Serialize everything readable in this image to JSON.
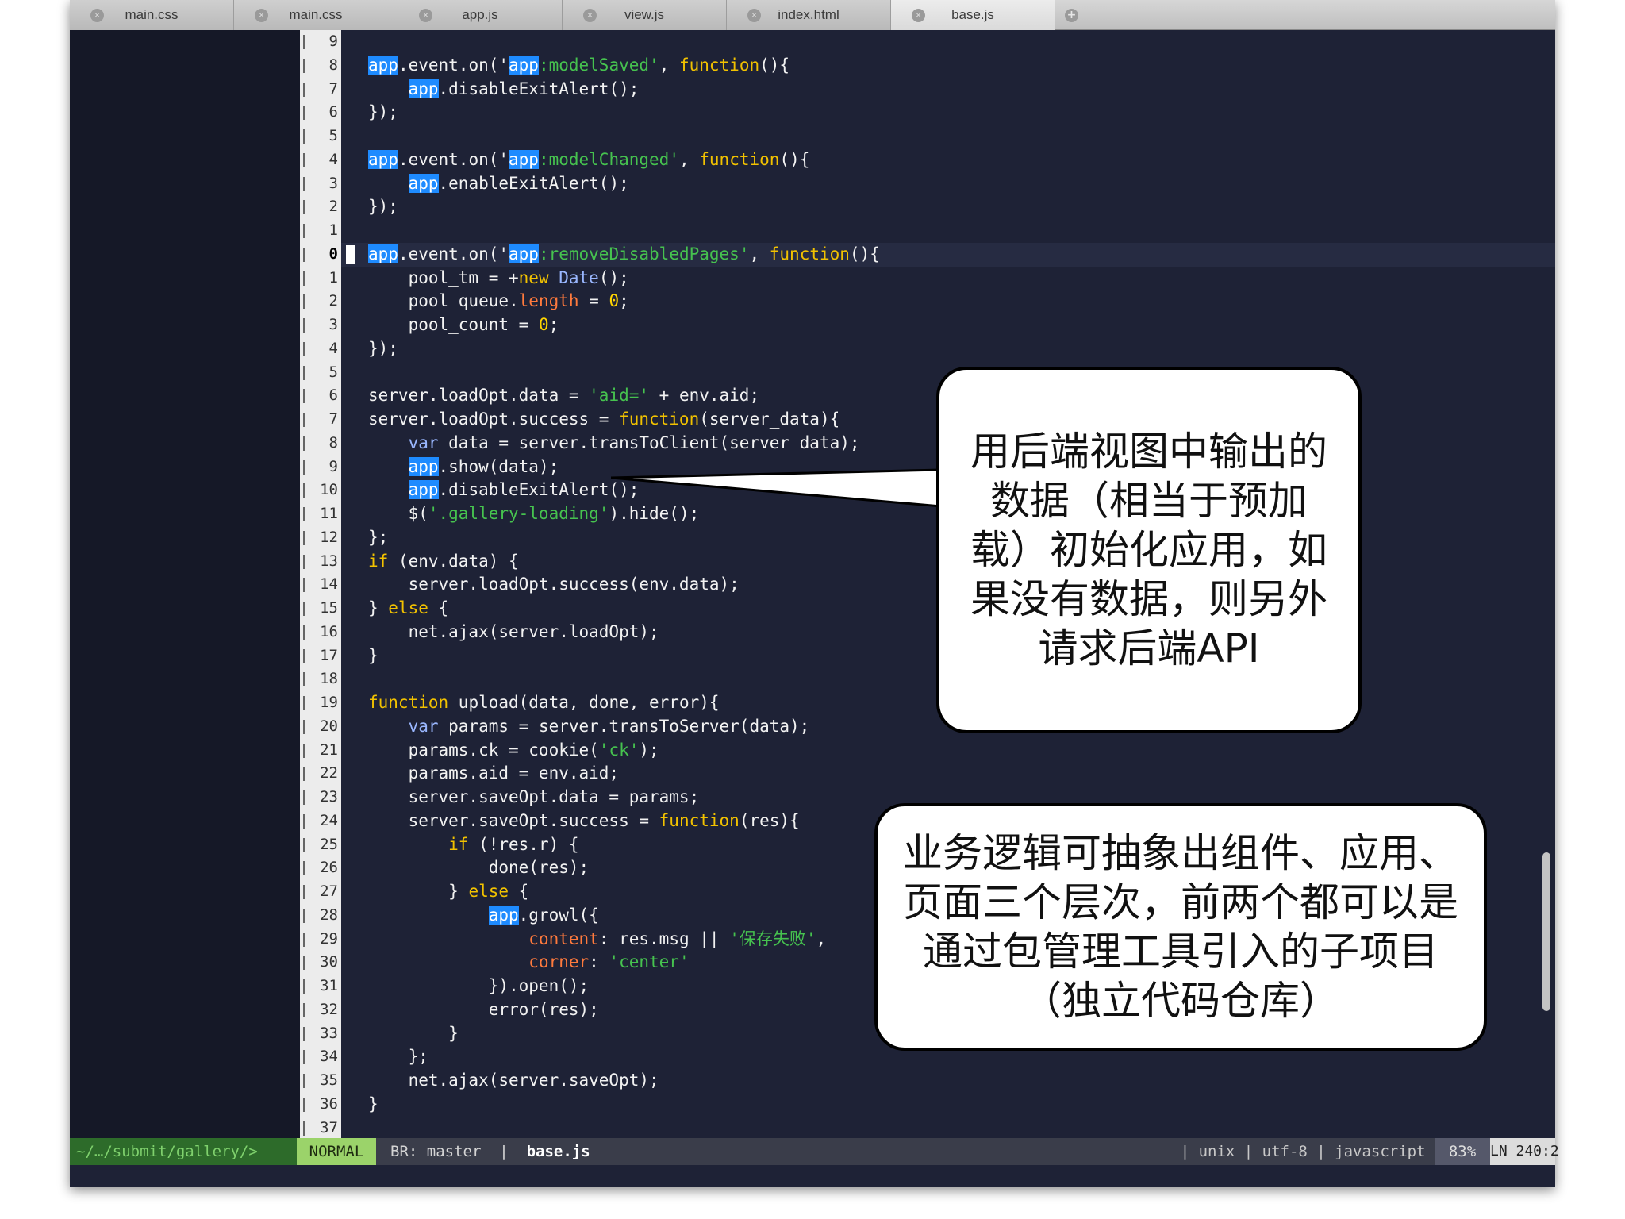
{
  "tabs": [
    "main.css",
    "main.css",
    "app.js",
    "view.js",
    "index.html",
    "base.js"
  ],
  "active_tab_index": 5,
  "code_lines": [
    {
      "num": "9",
      "html": ""
    },
    {
      "num": "8",
      "html": "<span class=\"hl\">app</span>.event.on('<span class=\"hl\">app</span><span class=\"str\">:modelSaved'</span>, <span class=\"kw\">function</span>(){"
    },
    {
      "num": "7",
      "html": "    <span class=\"hl\">app</span>.disableExitAlert();"
    },
    {
      "num": "6",
      "html": "});"
    },
    {
      "num": "5",
      "html": ""
    },
    {
      "num": "4",
      "html": "<span class=\"hl\">app</span>.event.on('<span class=\"hl\">app</span><span class=\"str\">:modelChanged'</span>, <span class=\"kw\">function</span>(){"
    },
    {
      "num": "3",
      "html": "    <span class=\"hl\">app</span>.enableExitAlert();"
    },
    {
      "num": "2",
      "html": "});"
    },
    {
      "num": "1",
      "html": ""
    },
    {
      "num": "0",
      "html": "<span class=\"hl\">app</span>.event.on('<span class=\"hl\">app</span><span class=\"str\">:removeDisabledPages'</span>, <span class=\"kw\">function</span>(){",
      "current": true
    },
    {
      "num": "1",
      "html": "    pool_tm = +<span class=\"kw\">new</span> <span class=\"blue\">Date</span>();"
    },
    {
      "num": "2",
      "html": "    pool_queue.<span class=\"prop\">length</span> = <span class=\"num0\">0</span>;"
    },
    {
      "num": "3",
      "html": "    pool_count = <span class=\"num0\">0</span>;"
    },
    {
      "num": "4",
      "html": "});"
    },
    {
      "num": "5",
      "html": ""
    },
    {
      "num": "6",
      "html": "server.loadOpt.data = <span class=\"str\">'aid='</span> + env.aid;"
    },
    {
      "num": "7",
      "html": "server.loadOpt.success = <span class=\"kw\">function</span>(server_data){"
    },
    {
      "num": "8",
      "html": "    <span class=\"blue\">var</span> data = server.transToClient(server_data);"
    },
    {
      "num": "9",
      "html": "    <span class=\"hl\">app</span>.show(data);"
    },
    {
      "num": "10",
      "html": "    <span class=\"hl\">app</span>.disableExitAlert();"
    },
    {
      "num": "11",
      "html": "    $(<span class=\"str\">'.gallery-loading'</span>).hide();"
    },
    {
      "num": "12",
      "html": "};"
    },
    {
      "num": "13",
      "html": "<span class=\"kw\">if</span> (env.data) {"
    },
    {
      "num": "14",
      "html": "    server.loadOpt.success(env.data);"
    },
    {
      "num": "15",
      "html": "} <span class=\"kw\">else</span> {"
    },
    {
      "num": "16",
      "html": "    net.ajax(server.loadOpt);"
    },
    {
      "num": "17",
      "html": "}"
    },
    {
      "num": "18",
      "html": ""
    },
    {
      "num": "19",
      "html": "<span class=\"kw\">function</span> upload(data, done, error){"
    },
    {
      "num": "20",
      "html": "    <span class=\"blue\">var</span> params = server.transToServer(data);"
    },
    {
      "num": "21",
      "html": "    params.ck = cookie(<span class=\"str\">'ck'</span>);"
    },
    {
      "num": "22",
      "html": "    params.aid = env.aid;"
    },
    {
      "num": "23",
      "html": "    server.saveOpt.data = params;"
    },
    {
      "num": "24",
      "html": "    server.saveOpt.success = <span class=\"kw\">function</span>(res){"
    },
    {
      "num": "25",
      "html": "        <span class=\"kw\">if</span> (!res.r) {"
    },
    {
      "num": "26",
      "html": "            done(res);"
    },
    {
      "num": "27",
      "html": "        } <span class=\"kw\">else</span> {"
    },
    {
      "num": "28",
      "html": "            <span class=\"hl\">app</span>.growl({"
    },
    {
      "num": "29",
      "html": "                <span class=\"prop\">content</span>: res.msg || <span class=\"str\">'保存失败'</span>,"
    },
    {
      "num": "30",
      "html": "                <span class=\"prop\">corner</span>: <span class=\"str\">'center'</span>"
    },
    {
      "num": "31",
      "html": "            }).open();"
    },
    {
      "num": "32",
      "html": "            error(res);"
    },
    {
      "num": "33",
      "html": "        }"
    },
    {
      "num": "34",
      "html": "    };"
    },
    {
      "num": "35",
      "html": "    net.ajax(server.saveOpt);"
    },
    {
      "num": "36",
      "html": "}"
    },
    {
      "num": "37",
      "html": ""
    }
  ],
  "status": {
    "path": "~/…/submit/gallery/>",
    "mode": "NORMAL",
    "branch": "BR: master  |  ",
    "file": "base.js",
    "right": "| unix | utf-8 | javascript ",
    "percent": "83%",
    "position": "LN 240:2"
  },
  "callouts": {
    "first": "用后端视图中输出的数据（相当于预加载）初始化应用，如果没有数据，则另外请求后端API",
    "second": "业务逻辑可抽象出组件、应用、页面三个层次，前两个都可以是通过包管理工具引入的子项目（独立代码仓库）"
  }
}
